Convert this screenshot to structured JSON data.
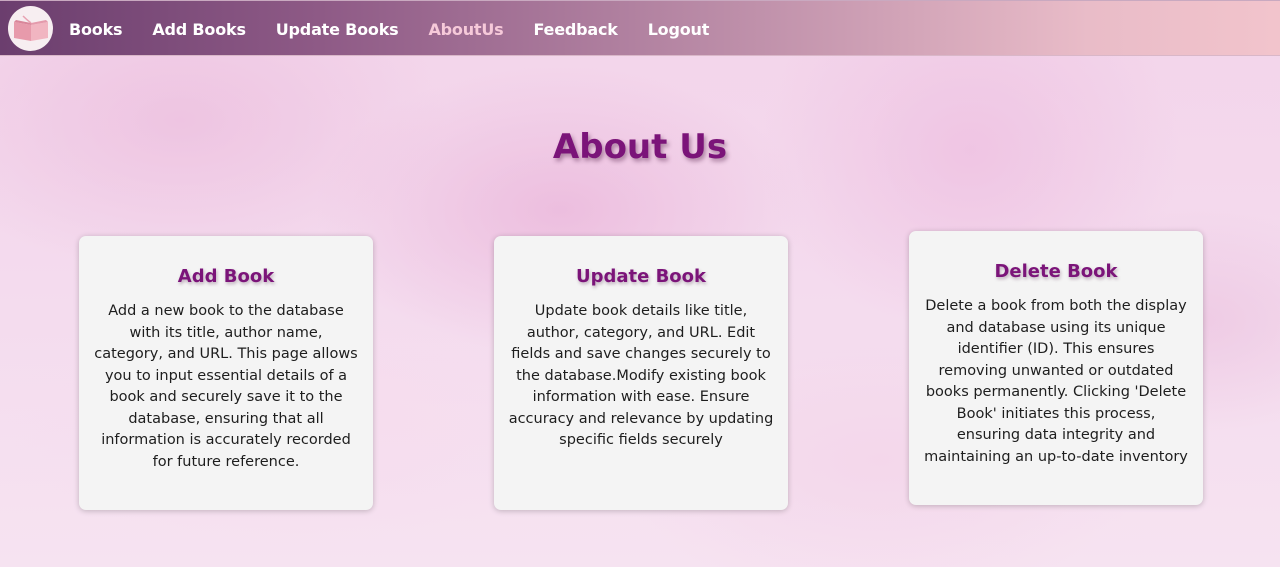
{
  "nav": {
    "logo_icon": "book-logo-icon",
    "links": [
      {
        "label": "Books",
        "active": false
      },
      {
        "label": "Add Books",
        "active": false
      },
      {
        "label": "Update Books",
        "active": false
      },
      {
        "label": "AboutUs",
        "active": true
      },
      {
        "label": "Feedback",
        "active": false
      },
      {
        "label": "Logout",
        "active": false
      }
    ],
    "active_color": "#f6c9d9"
  },
  "page": {
    "title": "About Us",
    "title_color": "#7b1479"
  },
  "cards": [
    {
      "title": "Add Book",
      "description": "Add a new book to the database with its title, author name, category, and URL. This page allows you to input essential details of a book and securely save it to the database, ensuring that all information is accurately recorded for future reference."
    },
    {
      "title": "Update Book",
      "description": "Update book details like title, author, category, and URL. Edit fields and save changes securely to the database.Modify existing book information with ease. Ensure accuracy and relevance by updating specific fields securely"
    },
    {
      "title": "Delete Book",
      "description": "Delete a book from both the display and database using its unique identifier (ID). This ensures removing unwanted or outdated books permanently. Clicking 'Delete Book' initiates this process, ensuring data integrity and maintaining an up-to-date inventory"
    }
  ]
}
